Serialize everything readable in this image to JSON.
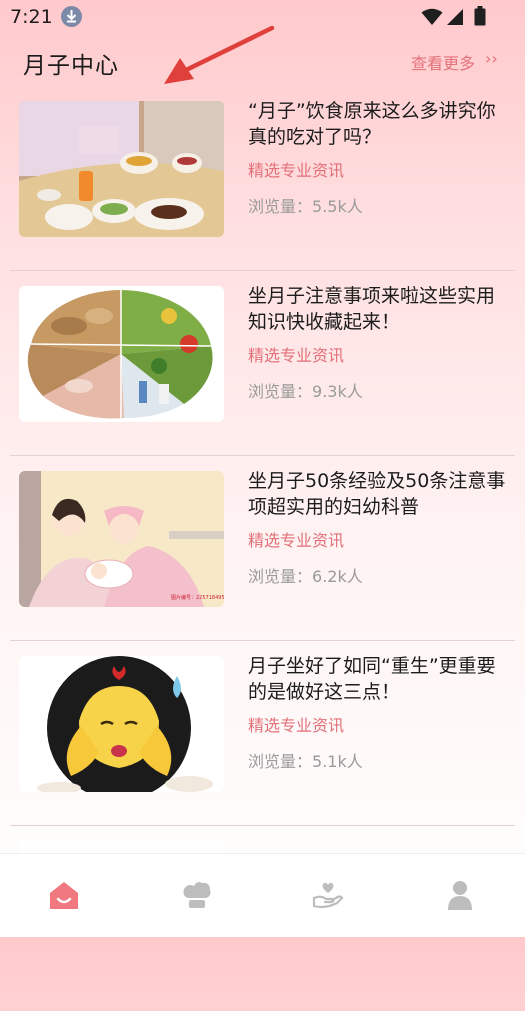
{
  "status_bar": {
    "time": "7:21"
  },
  "header": {
    "title": "月子中心",
    "more_label": "查看更多",
    "more_chevron": "››"
  },
  "articles": [
    {
      "title": "“月子”饮食原来这么多讲究你真的吃对了吗？",
      "tag": "精选专业资讯",
      "views_label": "浏览量：",
      "views": "5.5k人",
      "image": "postpartum-meal-photo"
    },
    {
      "title": "坐月子注意事项来啦这些实用知识快收藏起来！",
      "tag": "精选专业资讯",
      "views_label": "浏览量：",
      "views": "9.3k人",
      "image": "food-groups-plate-photo"
    },
    {
      "title": "坐月子50条经验及50条注意事项超实用的妇幼科普",
      "tag": "精选专业资讯",
      "views_label": "浏览量：",
      "views": "6.2k人",
      "image": "nurse-mother-baby-illustration"
    },
    {
      "title": "月子坐好了如同“重生”更重要的是做好这三点！",
      "tag": "精选专业资讯",
      "views_label": "浏览量：",
      "views": "5.1k人",
      "image": "emoji-character-illustration"
    }
  ],
  "bottom_nav": {
    "items": [
      {
        "icon": "home-icon",
        "active": true
      },
      {
        "icon": "chef-hat-icon",
        "active": false
      },
      {
        "icon": "care-hand-icon",
        "active": false
      },
      {
        "icon": "profile-icon",
        "active": false
      }
    ]
  },
  "colors": {
    "accent": "#e4737a",
    "active_nav": "#f0787e",
    "inactive_nav": "#bdbdbd"
  }
}
